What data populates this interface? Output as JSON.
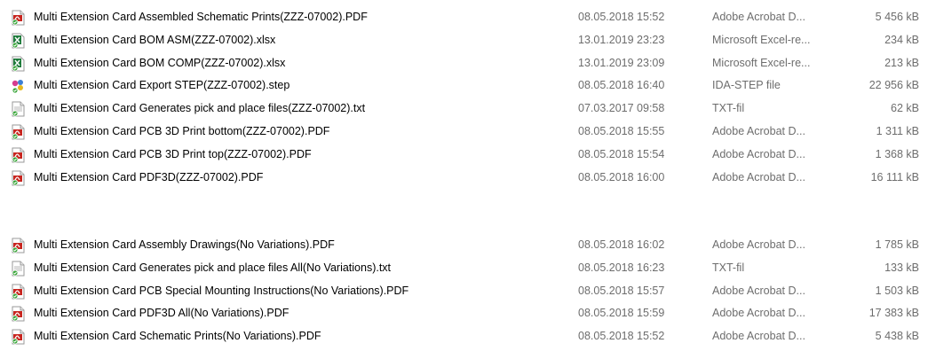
{
  "groups": [
    {
      "rows": [
        {
          "name": "Multi Extension Card Assembled Schematic Prints(ZZZ-07002).PDF",
          "date": "08.05.2018 15:52",
          "type": "Adobe Acrobat D...",
          "size": "5 456 kB",
          "icon": "pdf-icon"
        },
        {
          "name": "Multi Extension Card BOM ASM(ZZZ-07002).xlsx",
          "date": "13.01.2019 23:23",
          "type": "Microsoft Excel-re...",
          "size": "234 kB",
          "icon": "excel-icon"
        },
        {
          "name": "Multi Extension Card BOM COMP(ZZZ-07002).xlsx",
          "date": "13.01.2019 23:09",
          "type": "Microsoft Excel-re...",
          "size": "213 kB",
          "icon": "excel-icon"
        },
        {
          "name": "Multi Extension Card Export STEP(ZZZ-07002).step",
          "date": "08.05.2018 16:40",
          "type": "IDA-STEP file",
          "size": "22 956 kB",
          "icon": "step-icon"
        },
        {
          "name": "Multi Extension Card Generates pick and place files(ZZZ-07002).txt",
          "date": "07.03.2017 09:58",
          "type": "TXT-fil",
          "size": "62 kB",
          "icon": "txt-icon"
        },
        {
          "name": "Multi Extension Card PCB 3D Print bottom(ZZZ-07002).PDF",
          "date": "08.05.2018 15:55",
          "type": "Adobe Acrobat D...",
          "size": "1 311 kB",
          "icon": "pdf-icon"
        },
        {
          "name": "Multi Extension Card PCB 3D Print top(ZZZ-07002).PDF",
          "date": "08.05.2018 15:54",
          "type": "Adobe Acrobat D...",
          "size": "1 368 kB",
          "icon": "pdf-icon"
        },
        {
          "name": "Multi Extension Card PDF3D(ZZZ-07002).PDF",
          "date": "08.05.2018 16:00",
          "type": "Adobe Acrobat D...",
          "size": "16 111 kB",
          "icon": "pdf-icon"
        }
      ]
    },
    {
      "rows": [
        {
          "name": "Multi Extension Card Assembly Drawings(No Variations).PDF",
          "date": "08.05.2018 16:02",
          "type": "Adobe Acrobat D...",
          "size": "1 785 kB",
          "icon": "pdf-icon"
        },
        {
          "name": "Multi Extension Card Generates pick and place files All(No Variations).txt",
          "date": "08.05.2018 16:23",
          "type": "TXT-fil",
          "size": "133 kB",
          "icon": "txt-icon"
        },
        {
          "name": "Multi Extension Card PCB Special Mounting Instructions(No Variations).PDF",
          "date": "08.05.2018 15:57",
          "type": "Adobe Acrobat D...",
          "size": "1 503 kB",
          "icon": "pdf-icon"
        },
        {
          "name": "Multi Extension Card PDF3D All(No Variations).PDF",
          "date": "08.05.2018 15:59",
          "type": "Adobe Acrobat D...",
          "size": "17 383 kB",
          "icon": "pdf-icon"
        },
        {
          "name": "Multi Extension Card Schematic Prints(No Variations).PDF",
          "date": "08.05.2018 15:52",
          "type": "Adobe Acrobat D...",
          "size": "5 438 kB",
          "icon": "pdf-icon"
        }
      ]
    }
  ],
  "colors": {
    "pdf": "#c8251f",
    "excel": "#1d7a3a",
    "check": "#3aa53a",
    "text_secondary": "#6d6d6d"
  }
}
